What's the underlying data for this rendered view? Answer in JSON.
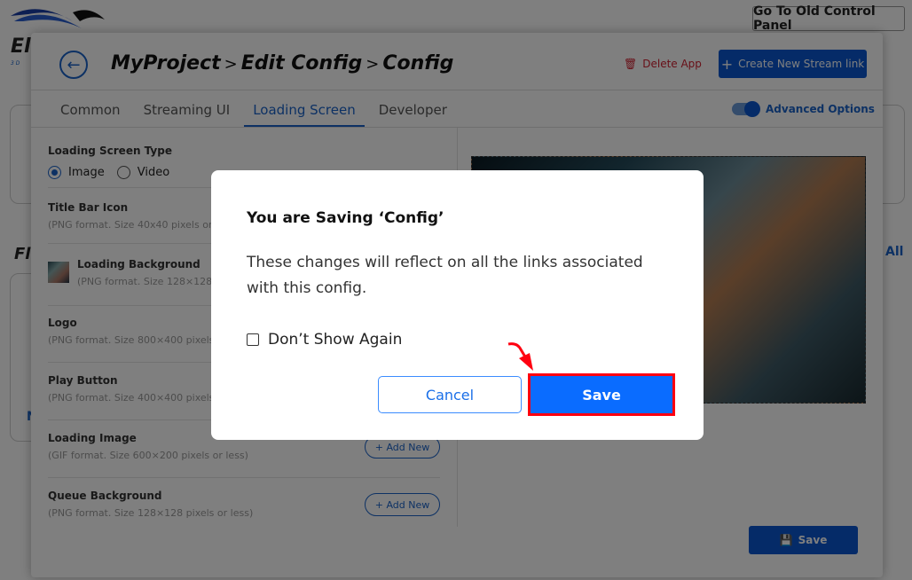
{
  "top": {
    "old_panel": "Go To Old Control Panel",
    "logo_fragment": "El",
    "logo_sub": "3 D",
    "frag_left": "Fl",
    "frag_all": "All",
    "frag_n": "N"
  },
  "header": {
    "breadcrumb": [
      "MyProject",
      "Edit Config",
      "Config"
    ],
    "separator": ">",
    "delete_label": "Delete App",
    "create_label": "Create New Stream link"
  },
  "tabs": [
    {
      "label": "Common"
    },
    {
      "label": "Streaming UI"
    },
    {
      "label": "Loading Screen",
      "active": true
    },
    {
      "label": "Developer"
    }
  ],
  "advanced": {
    "label": "Advanced Options",
    "enabled": true
  },
  "form": {
    "type_label": "Loading Screen Type",
    "type_options": [
      "Image",
      "Video"
    ],
    "selected": "Image",
    "fields": [
      {
        "label": "Title Bar Icon",
        "hint": "(PNG format. Size 40x40 pixels or l"
      },
      {
        "label": "Loading Background",
        "hint": "(PNG format. Size 128×128 p"
      },
      {
        "label": "Logo",
        "hint": "(PNG format. Size 800×400 pixels o"
      },
      {
        "label": "Play Button",
        "hint": "(PNG format. Size 400×400 pixels o"
      },
      {
        "label": "Loading Image",
        "hint": "(GIF format. Size 600×200 pixels or less)",
        "button": "+ Add New"
      },
      {
        "label": "Queue Background",
        "hint": "(PNG format. Size 128×128 pixels or less)",
        "button": "+ Add New"
      }
    ],
    "save_label": "Save"
  },
  "modal": {
    "title": "You are Saving ‘Config’",
    "body": "These changes will reflect on all the links associated with this config.",
    "checkbox": "Don’t Show Again",
    "checked": false,
    "cancel": "Cancel",
    "save": "Save"
  },
  "colors": {
    "primary": "#0a57d0",
    "modal_save": "#0a6cff",
    "highlight": "#ff0010",
    "danger": "#d02030"
  }
}
